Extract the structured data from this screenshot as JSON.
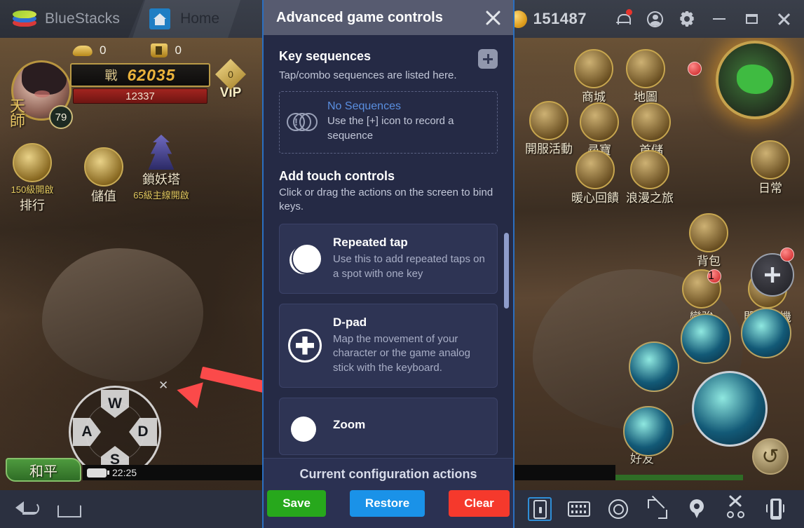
{
  "topbar": {
    "brand": "BlueStacks",
    "tab_label": "Home",
    "tab_icon": "home-icon",
    "coin_icon": "coin-icon",
    "coin_value": "151487",
    "notification_icon": "bell-icon",
    "account_icon": "avatar-icon",
    "settings_icon": "gear-icon",
    "minimize_icon": "minimize-icon",
    "maximize_icon": "maximize-icon",
    "close_icon": "close-icon"
  },
  "game": {
    "resources": [
      {
        "icon": "ingot-icon",
        "value": "0"
      },
      {
        "icon": "money-bag-icon",
        "value": "0"
      }
    ],
    "class_name": "天師",
    "level": "79",
    "power_label": "戰",
    "power_value": "62035",
    "hp_value": "12337",
    "vip_label": "VIP",
    "vip_level": "0",
    "left_buttons": [
      {
        "label": "排行",
        "sub": "150級開啟"
      },
      {
        "label": "儲值",
        "sub": ""
      },
      {
        "label": "鎖妖塔",
        "sub": "65級主線開啟"
      }
    ],
    "right_buttons": [
      {
        "label": "商城"
      },
      {
        "label": "地圖"
      },
      {
        "label": "開服活動"
      },
      {
        "label": "尋寶"
      },
      {
        "label": "首儲"
      },
      {
        "label": "日常"
      },
      {
        "label": "暖心回饋"
      },
      {
        "label": "浪漫之旅"
      },
      {
        "label": "背包"
      },
      {
        "label": "變強",
        "badge": "1"
      },
      {
        "label": "開啟掛機"
      }
    ],
    "chat_tag": "和平",
    "clock": "22:25",
    "friends_label": "好友",
    "dpad_keys": {
      "up": "W",
      "left": "A",
      "right": "D",
      "down": "S"
    },
    "dpad_close_icon": "close-icon",
    "dpad_resize_icon": "resize-handle-icon"
  },
  "sysbar": {
    "back_icon": "back-icon",
    "home_icon": "home-icon",
    "right_icons": [
      "tablet-lock-icon",
      "keyboard-icon",
      "eye-icon",
      "fullscreen-icon",
      "location-pin-icon",
      "scissors-icon",
      "shake-phone-icon"
    ]
  },
  "panel": {
    "title": "Advanced game controls",
    "close_icon": "close-icon",
    "key_sequences": {
      "title": "Key sequences",
      "subtitle": "Tap/combo sequences are listed here.",
      "add_icon": "plus-icon",
      "empty_icon": "sequence-circles-icon",
      "empty_title": "No Sequences",
      "empty_desc": "Use the [+] icon to record a sequence"
    },
    "touch_controls": {
      "title": "Add touch controls",
      "subtitle": "Click or drag the actions on the screen to bind keys.",
      "items": [
        {
          "icon": "repeated-tap-icon",
          "title": "Repeated tap",
          "desc": "Use this to add repeated taps on a spot with one key"
        },
        {
          "icon": "dpad-icon",
          "title": "D-pad",
          "desc": "Map the movement of your character or the game analog stick with the keyboard."
        },
        {
          "icon": "zoom-icon",
          "title": "Zoom",
          "desc": ""
        }
      ]
    },
    "footer": {
      "title": "Current configuration actions",
      "save_label": "Save",
      "restore_label": "Restore",
      "clear_label": "Clear",
      "save_color": "#27a81c",
      "restore_color": "#1a92e8",
      "clear_color": "#f5392c"
    }
  }
}
